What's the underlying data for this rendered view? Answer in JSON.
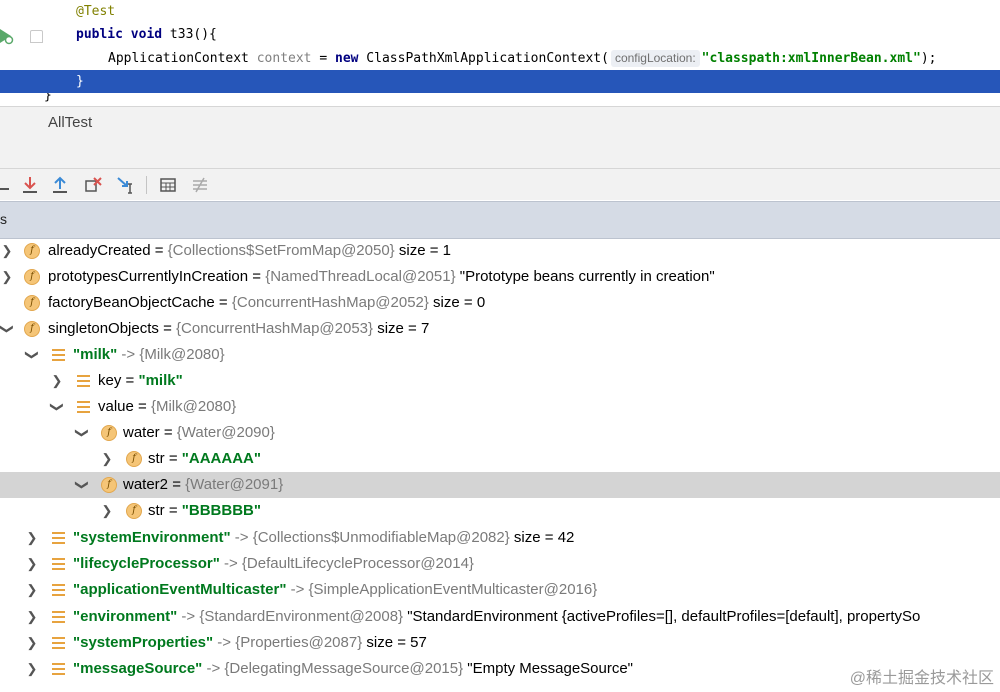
{
  "editor": {
    "line1": {
      "annotation": "@Test"
    },
    "line2": {
      "kw": "public void",
      "rest": " t33(){"
    },
    "line3": {
      "type": "ApplicationContext ",
      "var": "context",
      "eq": " = ",
      "kw_new": "new",
      "cls": " ClassPathXmlApplicationContext(",
      "hint": "configLocation:",
      "arg": "\"classpath:xmlInnerBean.xml\"",
      "end": ");"
    },
    "line4": {
      "text": "}"
    },
    "line5": {
      "text": "}"
    }
  },
  "debug": {
    "tab_label": "AllTest",
    "vars_header": "s"
  },
  "toolbar": {
    "icons": [
      "step-over-icon",
      "step-into-icon",
      "step-out-icon",
      "drop-frame-icon",
      "run-to-cursor-icon",
      "evaluate-icon",
      "trace-icon"
    ]
  },
  "tree": [
    {
      "name": "alreadyCreated",
      "sep": " = ",
      "ref": "{Collections$SetFromMap@2050}",
      "extra": "  size = 1"
    },
    {
      "name": "prototypesCurrentlyInCreation",
      "sep": " = ",
      "ref": "{NamedThreadLocal@2051}",
      "extra": " \"Prototype beans currently in creation\""
    },
    {
      "name": "factoryBeanObjectCache",
      "sep": " = ",
      "ref": "{ConcurrentHashMap@2052}",
      "extra": "  size = 0"
    },
    {
      "name": "singletonObjects",
      "sep": " = ",
      "ref": "{ConcurrentHashMap@2053}",
      "extra": "  size = 7"
    },
    {
      "name": "\"milk\"",
      "sep": " -> ",
      "ref": "{Milk@2080}",
      "extra": ""
    },
    {
      "name": "key",
      "sep": " = ",
      "ref": "",
      "extra": "\"milk\""
    },
    {
      "name": "value",
      "sep": " = ",
      "ref": "{Milk@2080}",
      "extra": ""
    },
    {
      "name": "water",
      "sep": " = ",
      "ref": "{Water@2090}",
      "extra": ""
    },
    {
      "name": "str",
      "sep": " = ",
      "ref": "",
      "extra": "\"AAAAAA\""
    },
    {
      "name": "water2",
      "sep": " = ",
      "ref": "{Water@2091}",
      "extra": ""
    },
    {
      "name": "str",
      "sep": " = ",
      "ref": "",
      "extra": "\"BBBBBB\""
    },
    {
      "name": "\"systemEnvironment\"",
      "sep": " -> ",
      "ref": "{Collections$UnmodifiableMap@2082}",
      "extra": "  size = 42"
    },
    {
      "name": "\"lifecycleProcessor\"",
      "sep": " -> ",
      "ref": "{DefaultLifecycleProcessor@2014}",
      "extra": ""
    },
    {
      "name": "\"applicationEventMulticaster\"",
      "sep": " -> ",
      "ref": "{SimpleApplicationEventMulticaster@2016}",
      "extra": ""
    },
    {
      "name": "\"environment\"",
      "sep": " -> ",
      "ref": "{StandardEnvironment@2008}",
      "extra": " \"StandardEnvironment {activeProfiles=[], defaultProfiles=[default], propertySo"
    },
    {
      "name": "\"systemProperties\"",
      "sep": " -> ",
      "ref": "{Properties@2087}",
      "extra": "  size = 57"
    },
    {
      "name": "\"messageSource\"",
      "sep": " -> ",
      "ref": "{DelegatingMessageSource@2015}",
      "extra": " \"Empty MessageSource\""
    }
  ],
  "watermark": "@稀土掘金技术社区",
  "colors": {
    "selection": "#2656b9",
    "string": "#00791e",
    "header": "#d5dbe5"
  }
}
